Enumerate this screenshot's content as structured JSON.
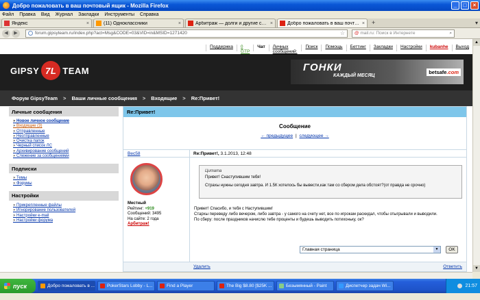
{
  "window": {
    "title": "Добро пожаловать в ваш почтовый ящик - Mozilla Firefox"
  },
  "menu": [
    "Файл",
    "Правка",
    "Вид",
    "Журнал",
    "Закладки",
    "Инструменты",
    "Справка"
  ],
  "tabs": [
    {
      "label": "Яндекс",
      "icon_color": "#d33"
    },
    {
      "label": "(11) Одноклассники",
      "icon_color": "#f90"
    },
    {
      "label": "Арбитраж — долги и другие спорные ...",
      "icon_color": "#d21"
    },
    {
      "label": "Добро пожаловать в ваш почтовый ящ...",
      "icon_color": "#d21",
      "active": true
    }
  ],
  "nav": {
    "url": "forum.gipsyteam.ru/index.php?act=Msg&CODE=03&VID=in&MSID=1271420",
    "search_placeholder": "mail.ru: Поиск в Интернете",
    "search_prefix": "@"
  },
  "toplinks": [
    "Поддержка",
    "0 GTP",
    "Чат",
    "Личных сообщений: 0",
    "Поиск",
    "Помощь",
    "Беттинг",
    "Закладки",
    "Настройки",
    "kubanhe",
    "Выход"
  ],
  "logo": {
    "left": "GIPSY",
    "mark": "7L",
    "right": "TEAM"
  },
  "banner": {
    "line1": "ГОНКИ",
    "line2": "КАЖДЫЙ МЕСЯЦ",
    "brand": "betsafe",
    "brand_suffix": ".com"
  },
  "breadcrumbs": [
    "Форум GipsyTeam",
    "Ваши личные сообщения",
    "Входящие",
    "Re:Привет!"
  ],
  "sidebar": {
    "pm_header": "Личные сообщения",
    "pm_items": [
      "Новое личное сообщение",
      "Входящие (3)",
      "Отправленные",
      "Неотправленные",
      "Очистка папок",
      "Черный список ЛС",
      "Архивирование сообщений",
      "Слежение за сообщениями"
    ],
    "subs_header": "Подписки",
    "subs_items": [
      "Темы",
      "Форумы"
    ],
    "settings_header": "Настройки",
    "settings_items": [
      "Прикрепленные файлы",
      "Игнорирование пользователей",
      "Настройки e-mail",
      "Настройки форума"
    ]
  },
  "message": {
    "title": "Re:Привет!",
    "section": "Сообщение",
    "prev": "← предыдущее",
    "pager_sep": "|",
    "next": "следующее →",
    "author": "Вес58",
    "date_prefix": "Re:Привет!,",
    "date": "3.1.2013, 12:48",
    "rank": "Местный",
    "rating_label": "Рейтинг:",
    "rating_value": "+919",
    "posts": "Сообщений: 3495",
    "onsite": "На сайте: 2 года",
    "arbitrage": "Арбитраж!",
    "quote_label": "Цитата",
    "quote_line1": "Привет! Снаступившим тебя!",
    "quote_line2": "Страхы нужны сегодня завтра. И 1.5К хотелось бы вывести,как там со сбером дела обстоят?(от правда не срочно)",
    "reply_line1": "Привет! Спасибо, и тебя с Наступившим!",
    "reply_line2": "Стархы переведу либо вечером, либо завтра - у самого на счету нет, все по игрокам раскидал, чтобы отыгрывали и выводили.",
    "reply_line3": "По сберу: после праздников начислю тебе проценты и будешь выводить потихоньку, ок?",
    "delete": "Удалить",
    "answer": "Ответить"
  },
  "jump": {
    "selected": "Главная страница",
    "ok": "OK"
  },
  "taskbar": {
    "start": "пуск",
    "items": [
      {
        "label": "Добро пожаловать в ...",
        "color": "#f90"
      },
      {
        "label": "PokerStars Lobby - L...",
        "color": "#d21"
      },
      {
        "label": "Find a Player",
        "color": "#d21"
      },
      {
        "label": "The Big $8.80 [$25K ...",
        "color": "#d21"
      },
      {
        "label": "Безымянный - Paint",
        "color": "#8c8"
      },
      {
        "label": "Диспетчер задач Wi...",
        "color": "#39f"
      }
    ],
    "clock": "21:57"
  },
  "colors": {
    "titlebar": "#0a57d6",
    "header": "#1e1e1e",
    "accent_red": "#d62b23",
    "msg_header": "#7ec6ea"
  }
}
